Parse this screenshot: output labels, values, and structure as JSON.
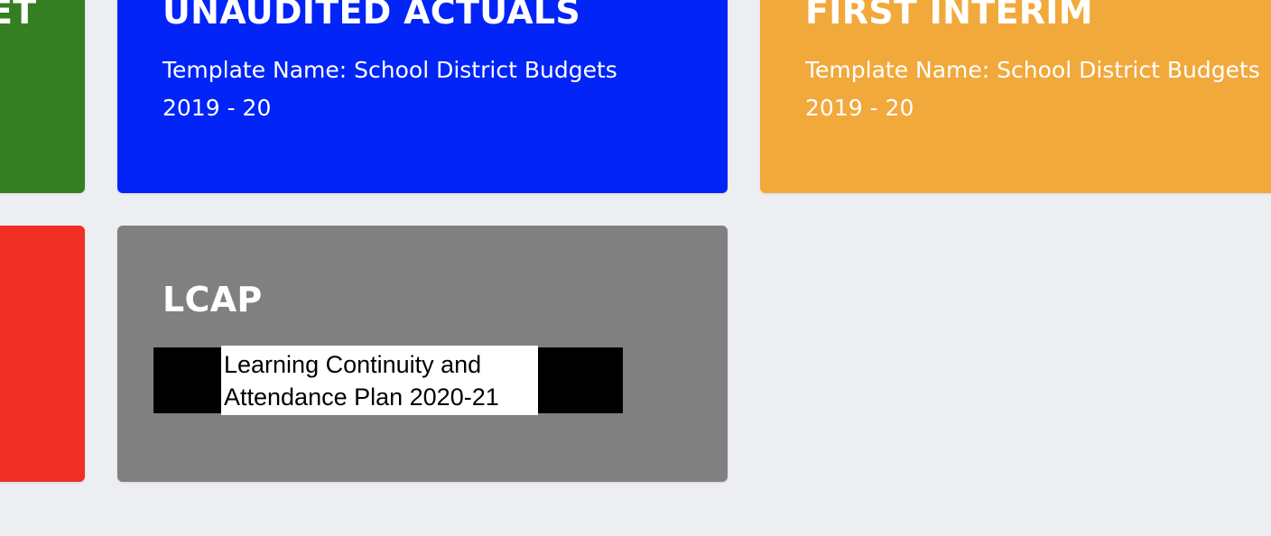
{
  "colors": {
    "page_bg": "#edeef2",
    "budget_green": "#367e22",
    "unaudited_blue": "#0224f6",
    "first_interim_orange": "#f1a93c",
    "red": "#f03024",
    "lcap_gray": "#808080"
  },
  "cards": {
    "budget": {
      "title_fragment": "ET"
    },
    "unaudited_actuals": {
      "title": "UNAUDITED ACTUALS",
      "template_line": "Template Name: School District Budgets",
      "year": "2019 - 20"
    },
    "first_interim": {
      "title": "FIRST INTERIM",
      "template_line": "Template Name: School District Budgets",
      "year": "2019 - 20"
    },
    "lcap": {
      "title": "LCAP",
      "label_line_1": "Learning Continuity and",
      "label_line_2": "Attendance Plan  2020-21"
    }
  }
}
